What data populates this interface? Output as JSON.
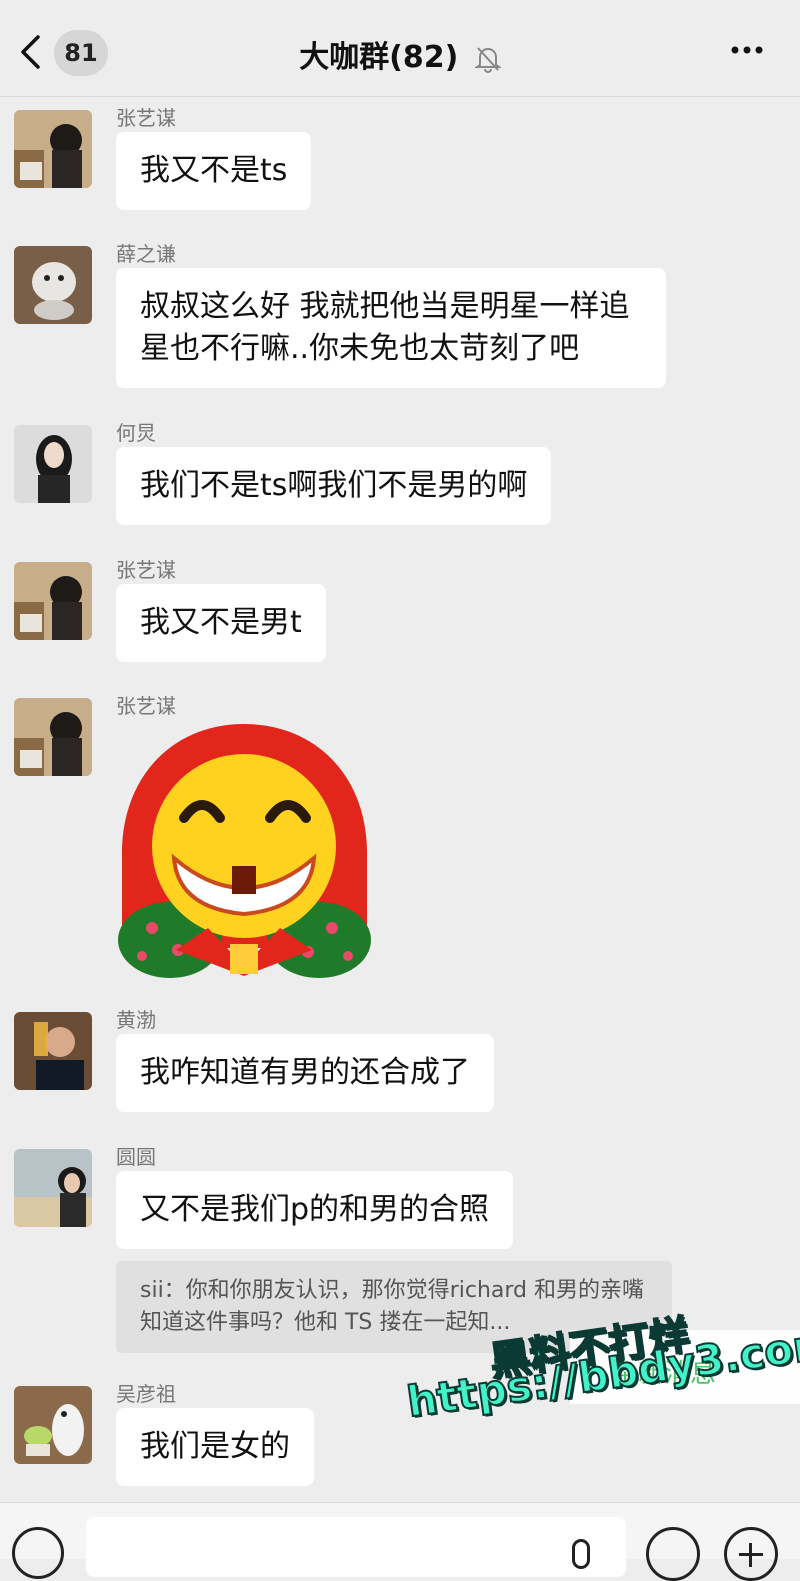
{
  "header": {
    "unread_count": "81",
    "title": "大咖群(82)"
  },
  "messages": [
    {
      "sender": "张艺谋",
      "text": "我又不是ts"
    },
    {
      "sender": "薛之谦",
      "text": "叔叔这么好 我就把他当是明星一样追星也不行嘛..你未免也太苛刻了吧"
    },
    {
      "sender": "何炅",
      "text": "我们不是ts啊我们不是男的啊"
    },
    {
      "sender": "张艺谋",
      "text": "我又不是男t"
    },
    {
      "sender": "张艺谋",
      "sticker": "grinning-face-red-hood-sticker"
    },
    {
      "sender": "黄渤",
      "text": "我咋知道有男的还合成了"
    },
    {
      "sender": "圆圆",
      "text": "又不是我们p的和男的合照",
      "quote": "sii：你和你朋友认识，那你觉得richard 和男的亲嘴知道这件事吗？他和 TS 搂在一起知..."
    },
    {
      "sender": "吴彦祖",
      "text": "我们是女的"
    }
  ],
  "watermark": {
    "line1": "黑料不打烊",
    "line2": "https://bbdy3.com",
    "partial_link": "条新消息"
  },
  "colors": {
    "background": "#ededed",
    "bubble": "#ffffff",
    "watermark": "#42f2c8"
  }
}
